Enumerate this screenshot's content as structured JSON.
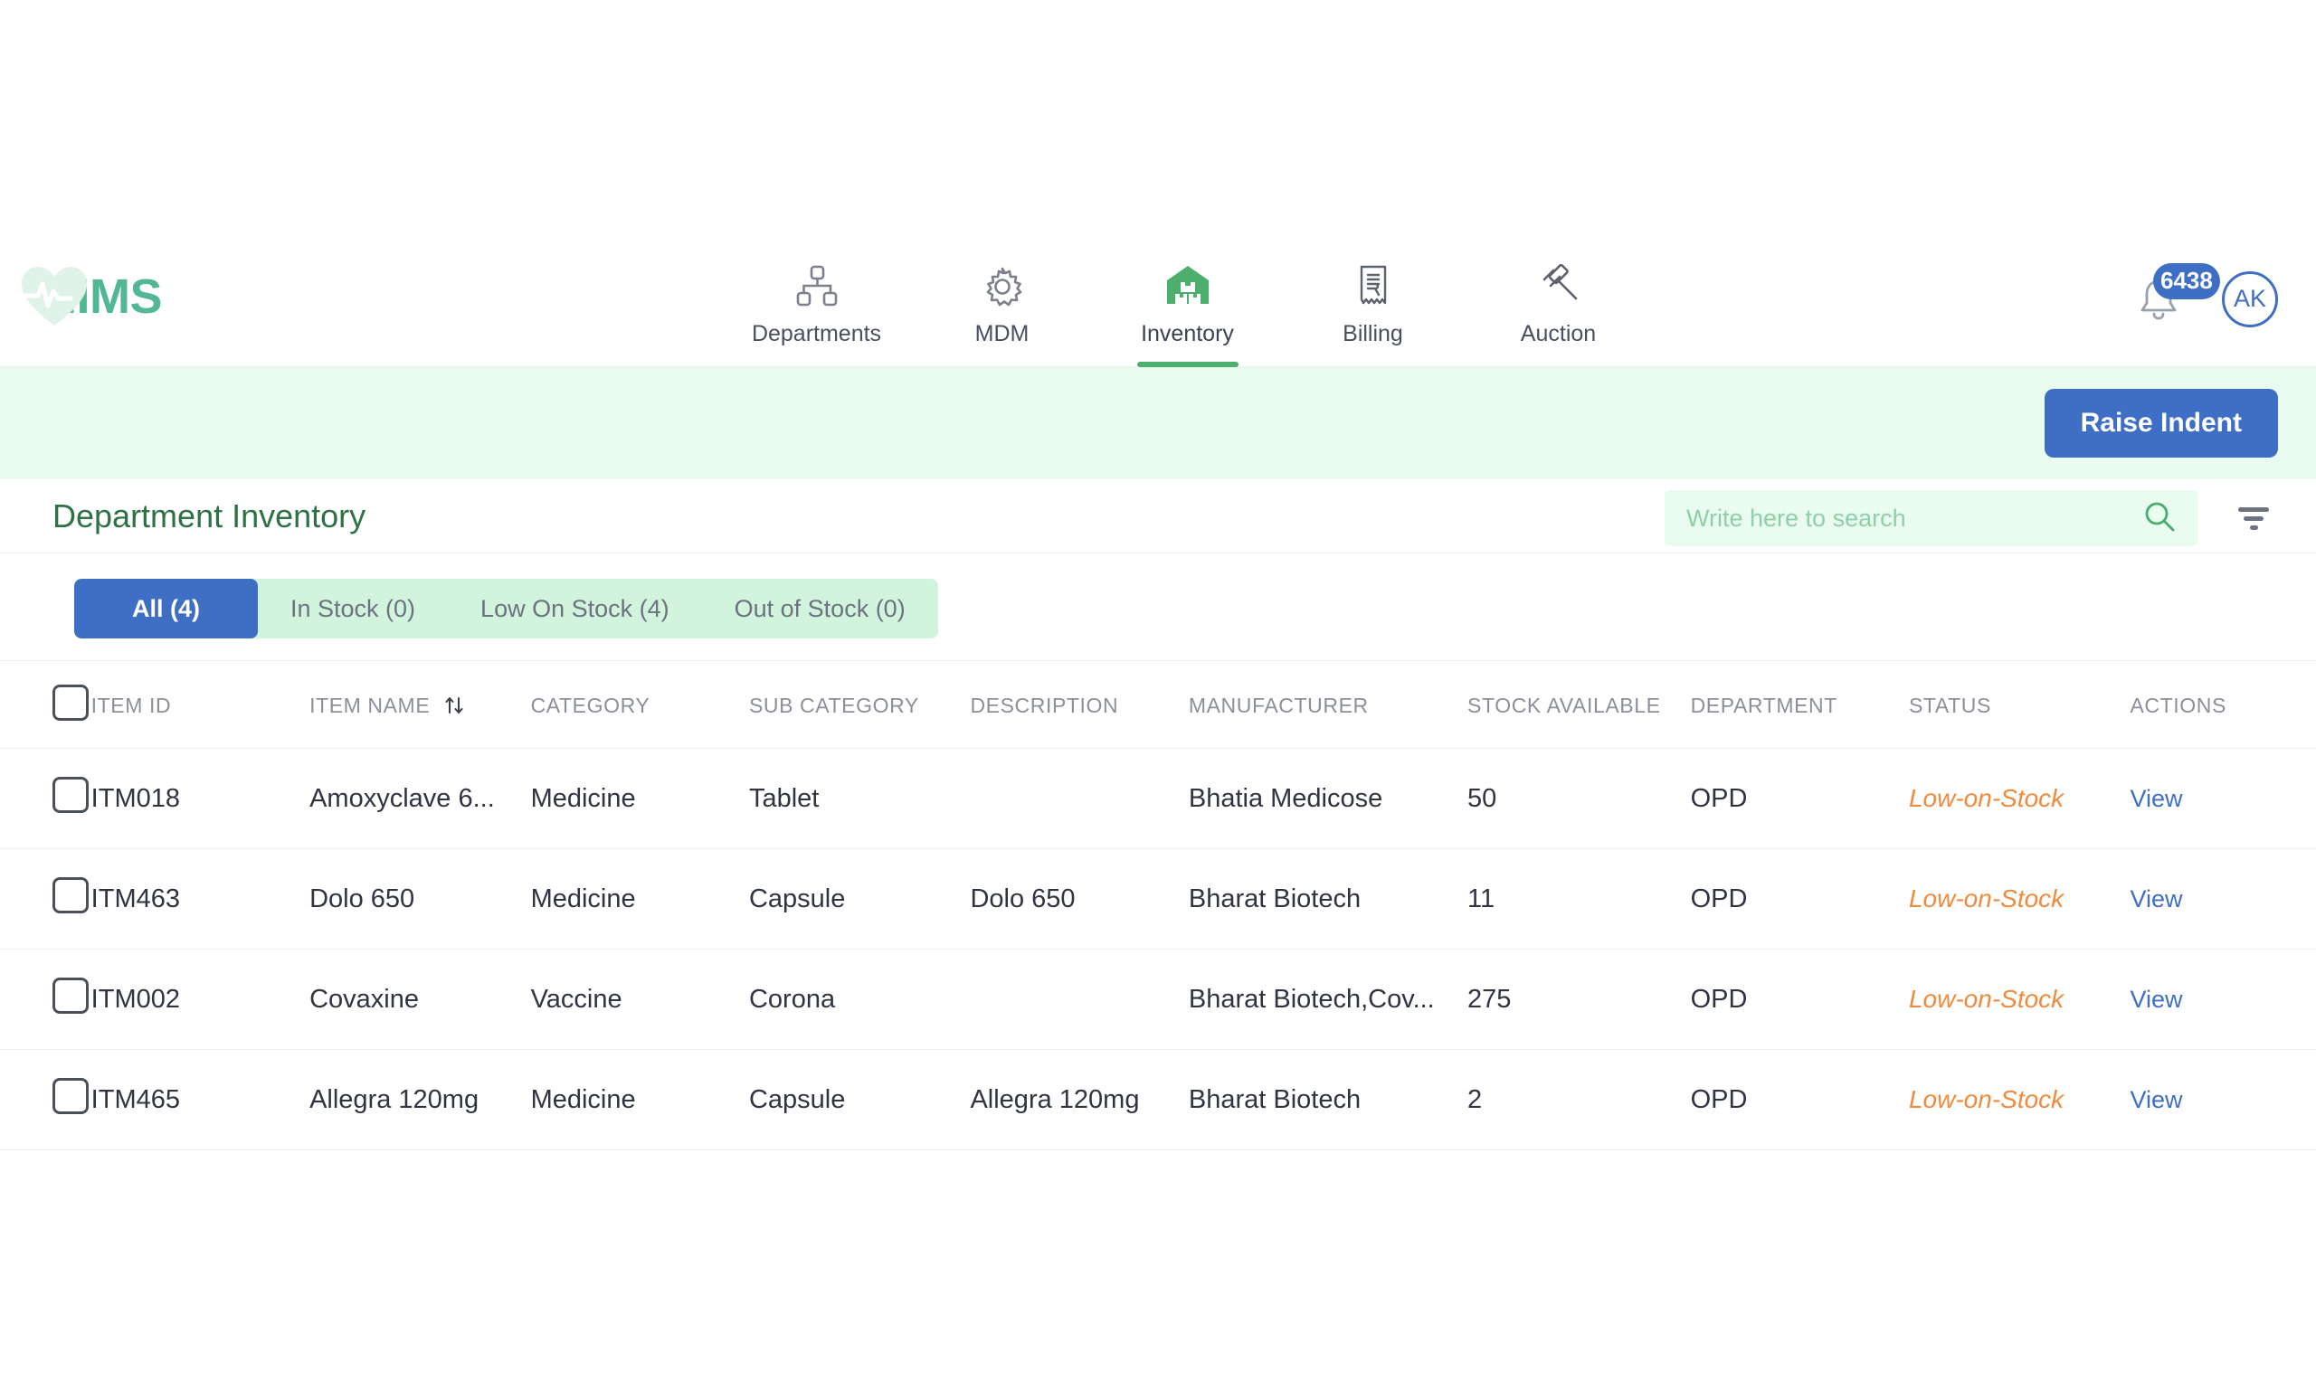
{
  "brand": {
    "name": "HIMS",
    "color": "#52b894"
  },
  "nav": {
    "items": [
      {
        "label": "Departments",
        "icon": "org-chart-icon",
        "active": false
      },
      {
        "label": "MDM",
        "icon": "gear-icon",
        "active": false
      },
      {
        "label": "Inventory",
        "icon": "warehouse-icon",
        "active": true
      },
      {
        "label": "Billing",
        "icon": "receipt-rupee-icon",
        "active": false
      },
      {
        "label": "Auction",
        "icon": "gavel-icon",
        "active": false
      }
    ],
    "notification_count": "6438",
    "avatar_initials": "AK",
    "accent_blue": "#3f6fc4",
    "accent_green": "#4caf6d"
  },
  "banner": {
    "raise_indent_label": "Raise Indent"
  },
  "header": {
    "page_title": "Department Inventory",
    "search_placeholder": "Write here to search",
    "search_value": "",
    "filter_label": "Filter"
  },
  "tabs": [
    {
      "label": "All (4)",
      "active": true
    },
    {
      "label": "In Stock (0)",
      "active": false
    },
    {
      "label": "Low On Stock (4)",
      "active": false
    },
    {
      "label": "Out of Stock (0)",
      "active": false
    }
  ],
  "table": {
    "columns": [
      "ITEM ID",
      "ITEM NAME",
      "CATEGORY",
      "SUB CATEGORY",
      "DESCRIPTION",
      "MANUFACTURER",
      "STOCK AVAILABLE",
      "DEPARTMENT",
      "STATUS",
      "ACTIONS"
    ],
    "sortable_column": "ITEM NAME",
    "action_label": "View",
    "rows": [
      {
        "item_id": "ITM018",
        "item_name": "Amoxyclave 6...",
        "category": "Medicine",
        "sub_category": "Tablet",
        "description": "",
        "manufacturer": "Bhatia Medicose",
        "stock_available": "50",
        "department": "OPD",
        "status": "Low-on-Stock",
        "action": "View"
      },
      {
        "item_id": "ITM463",
        "item_name": "Dolo 650",
        "category": "Medicine",
        "sub_category": "Capsule",
        "description": "Dolo 650",
        "manufacturer": "Bharat Biotech",
        "stock_available": "11",
        "department": "OPD",
        "status": "Low-on-Stock",
        "action": "View"
      },
      {
        "item_id": "ITM002",
        "item_name": "Covaxine",
        "category": "Vaccine",
        "sub_category": "Corona",
        "description": "",
        "manufacturer": "Bharat Biotech,Cov...",
        "stock_available": "275",
        "department": "OPD",
        "status": "Low-on-Stock",
        "action": "View"
      },
      {
        "item_id": "ITM465",
        "item_name": "Allegra 120mg",
        "category": "Medicine",
        "sub_category": "Capsule",
        "description": "Allegra 120mg",
        "manufacturer": "Bharat Biotech",
        "stock_available": "2",
        "department": "OPD",
        "status": "Low-on-Stock",
        "action": "View"
      }
    ]
  },
  "colors": {
    "status_low": "#f08a3c",
    "link": "#3f6fc4",
    "title_green": "#2e7145",
    "banner_green": "#eafcf0",
    "tab_strip_green": "#d2f4dc"
  }
}
